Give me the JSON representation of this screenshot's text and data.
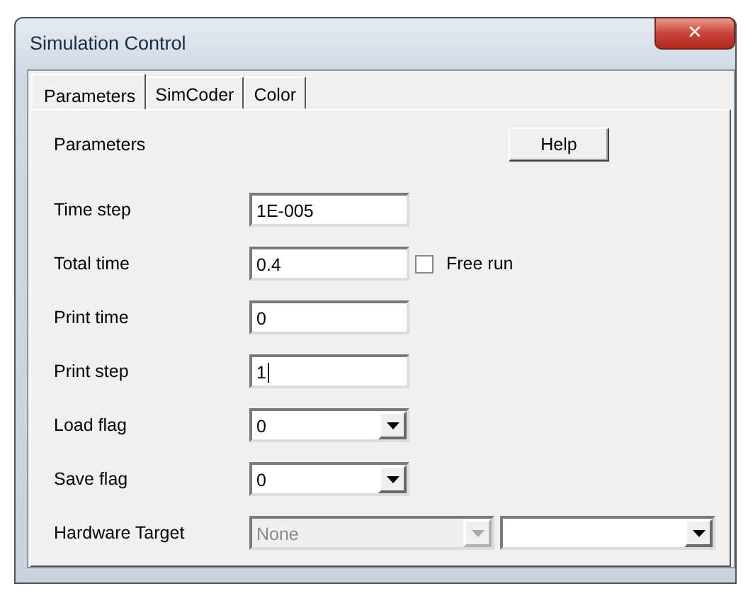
{
  "window": {
    "title": "Simulation Control",
    "close_button": "✕"
  },
  "tabs": [
    {
      "label": "Parameters",
      "selected": true
    },
    {
      "label": "SimCoder",
      "selected": false
    },
    {
      "label": "Color",
      "selected": false
    }
  ],
  "section_label": "Parameters",
  "help_button": "Help",
  "rows": [
    {
      "kind": "text",
      "label": "Time step",
      "value": "1E-005",
      "focused": false
    },
    {
      "kind": "text",
      "label": "Total time",
      "value": "0.4",
      "focused": false,
      "checkbox": {
        "label": "Free run",
        "checked": false
      }
    },
    {
      "kind": "text",
      "label": "Print time",
      "value": "0",
      "focused": false
    },
    {
      "kind": "text",
      "label": "Print step",
      "value": "1",
      "focused": true
    },
    {
      "kind": "combo",
      "label": "Load flag",
      "combos": [
        {
          "value": "0",
          "disabled": false
        }
      ]
    },
    {
      "kind": "combo",
      "label": "Save flag",
      "combos": [
        {
          "value": "0",
          "disabled": false
        }
      ]
    },
    {
      "kind": "combo",
      "label": "Hardware Target",
      "combos": [
        {
          "value": "None",
          "disabled": true
        },
        {
          "disabled": false
        }
      ]
    }
  ]
}
